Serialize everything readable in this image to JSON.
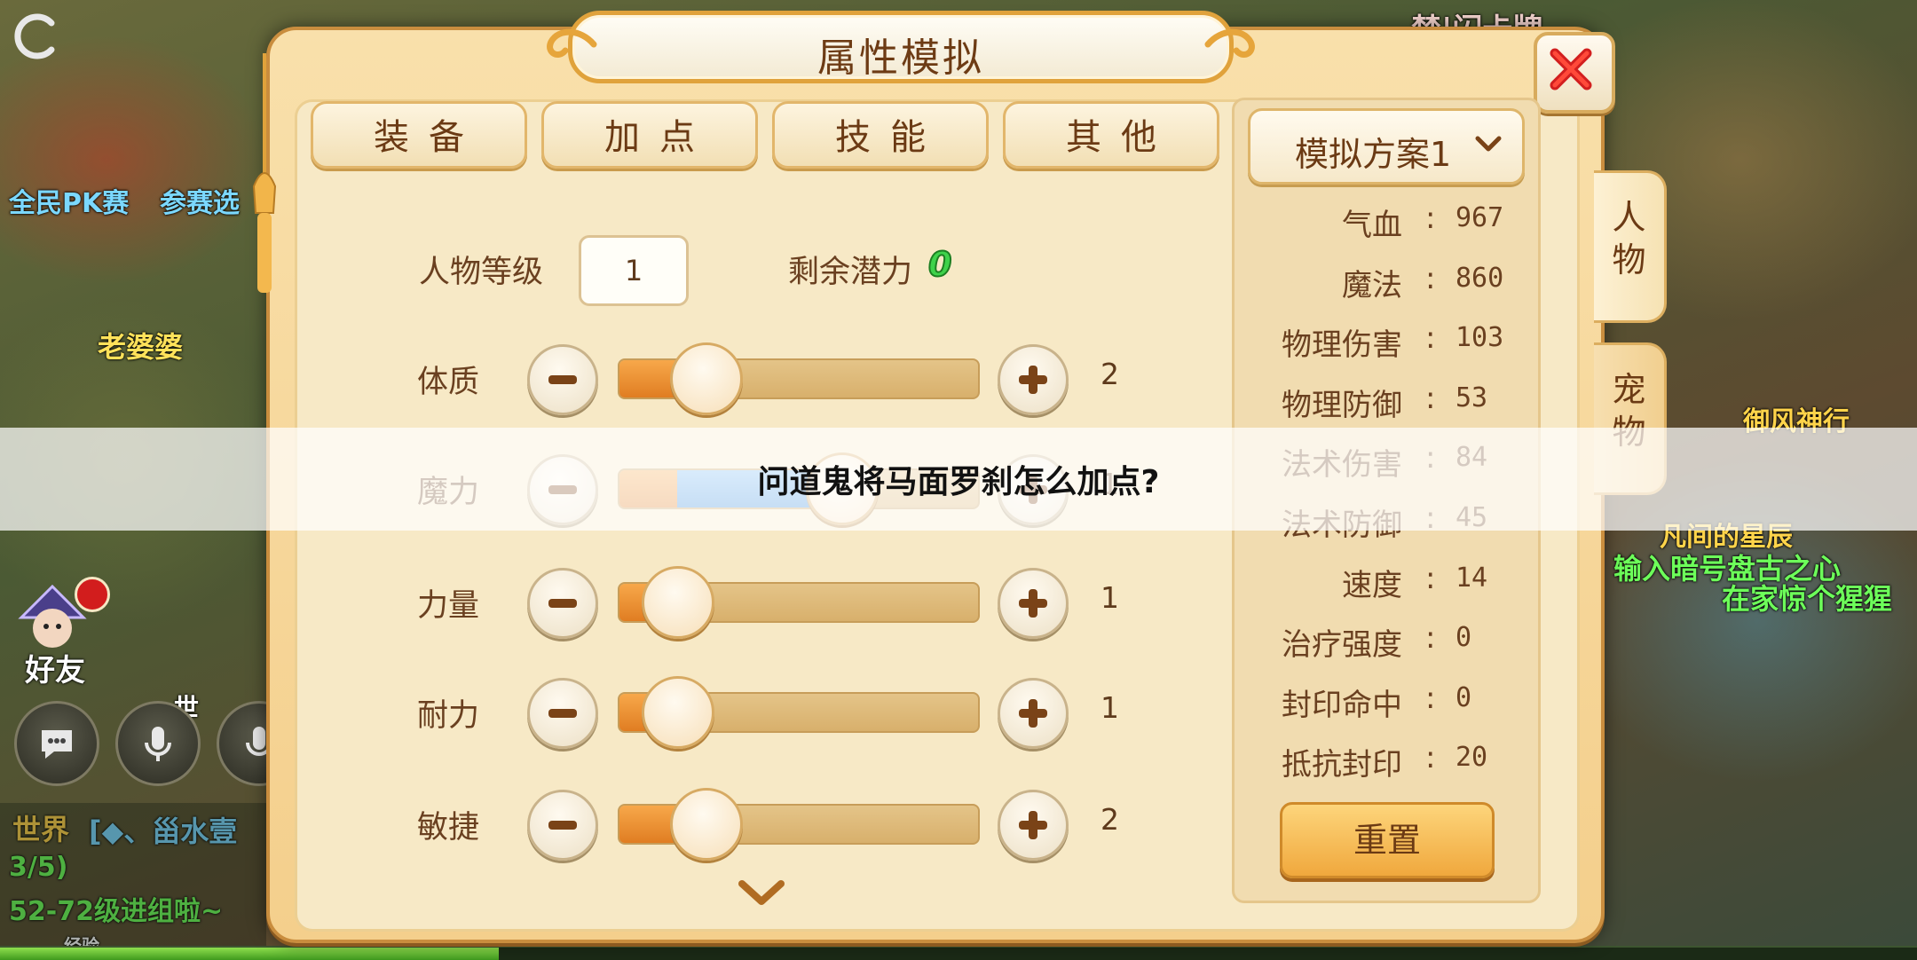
{
  "colors": {
    "panel": "#f4cf8c",
    "active_tab": "#f0a13a",
    "potential_value": "#3fd24b",
    "slider_orange": "#e07d22",
    "slider_blue": "#3689d9"
  },
  "background": {
    "texts": [
      {
        "id": "bg-top-label",
        "text": "禁|闪卡牌"
      },
      {
        "id": "bg-pk-text",
        "text": "全民PK赛"
      },
      {
        "id": "bg-select-text",
        "text": "参赛选"
      },
      {
        "id": "bg-npc-name",
        "text": "老婆婆"
      },
      {
        "id": "bg-yufeng",
        "text": "御风神行"
      },
      {
        "id": "bg-star-text",
        "text": "凡间的星辰"
      },
      {
        "id": "bg-input-code",
        "text": "输入暗号盘古之心"
      },
      {
        "id": "bg-home-text",
        "text": "在家惊个猩猩"
      },
      {
        "id": "bg-world-channel",
        "text": "世界"
      },
      {
        "id": "bg-chat-1",
        "text": "[◆、甾水壹"
      },
      {
        "id": "bg-chat-2",
        "text": "3/5)"
      },
      {
        "id": "bg-chat-3",
        "text": "52-72级进组啦~"
      },
      {
        "id": "bg-exp-label",
        "text": "经验"
      },
      {
        "id": "bg-world-tag",
        "text": "世"
      }
    ],
    "friend_label": "好友",
    "icons": [
      "refresh-icon",
      "chat-bubble-icon",
      "microphone-icon"
    ],
    "exp_fraction": 0.26
  },
  "panel": {
    "title": "属性模拟",
    "tabs": [
      {
        "id": "equipment",
        "label": "装备",
        "active": false
      },
      {
        "id": "add-points",
        "label": "加点",
        "active": true
      },
      {
        "id": "skills",
        "label": "技能",
        "active": false
      },
      {
        "id": "other",
        "label": "其他",
        "active": false
      }
    ],
    "level_label": "人物等级",
    "level_value": "1",
    "remaining_label": "剩余潜力",
    "remaining_value": "0",
    "stats": [
      {
        "id": "constitution",
        "name": "体质",
        "value": "2",
        "orange": 0.16,
        "blue": 0.08
      },
      {
        "id": "magic",
        "name": "魔力",
        "value": "1",
        "orange": 0.16,
        "blue": 0.46
      },
      {
        "id": "strength",
        "name": "力量",
        "value": "1",
        "orange": 0.16,
        "blue": 0.0
      },
      {
        "id": "endurance",
        "name": "耐力",
        "value": "1",
        "orange": 0.16,
        "blue": 0.0
      },
      {
        "id": "agility",
        "name": "敏捷",
        "value": "2",
        "orange": 0.16,
        "blue": 0.08
      }
    ],
    "scheme": "模拟方案1",
    "attributes": [
      {
        "id": "hp",
        "name": "气血",
        "value": "967"
      },
      {
        "id": "mp",
        "name": "魔法",
        "value": "860"
      },
      {
        "id": "phys-dmg",
        "name": "物理伤害",
        "value": "103"
      },
      {
        "id": "phys-def",
        "name": "物理防御",
        "value": "53"
      },
      {
        "id": "spell-dmg",
        "name": "法术伤害",
        "value": "84"
      },
      {
        "id": "spell-def",
        "name": "法术防御",
        "value": "45"
      },
      {
        "id": "speed",
        "name": "速度",
        "value": "14"
      },
      {
        "id": "heal",
        "name": "治疗强度",
        "value": "0"
      },
      {
        "id": "seal-hit",
        "name": "封印命中",
        "value": "0"
      },
      {
        "id": "seal-resist",
        "name": "抵抗封印",
        "value": "20"
      }
    ],
    "separator": ":",
    "reset_label": "重置",
    "side_tabs": [
      {
        "id": "person",
        "label": "人物"
      },
      {
        "id": "pet",
        "label": "宠物"
      }
    ]
  },
  "overlay_caption": "问道鬼将马面罗刹怎么加点?"
}
